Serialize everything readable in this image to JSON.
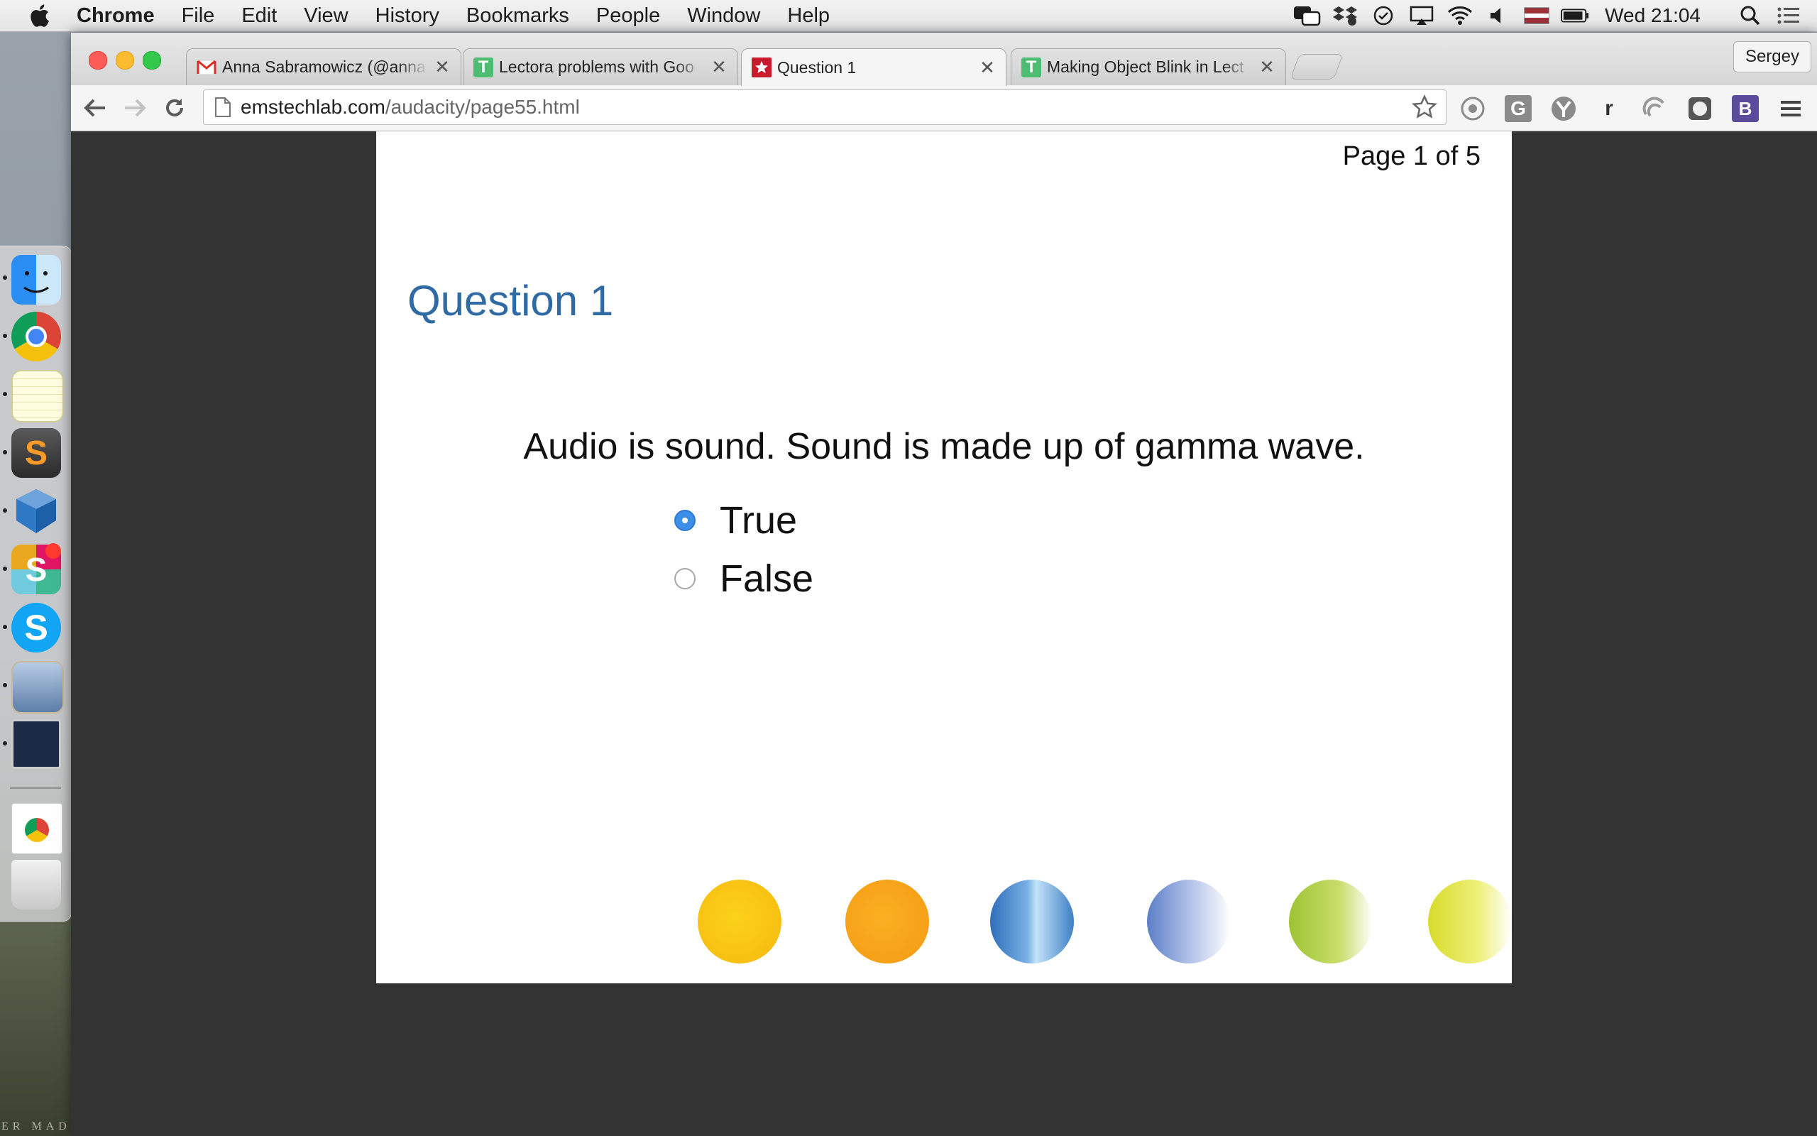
{
  "menubar": {
    "app_name": "Chrome",
    "items": [
      "File",
      "Edit",
      "View",
      "History",
      "Bookmarks",
      "People",
      "Window",
      "Help"
    ],
    "clock": "Wed 21:04"
  },
  "tabs": [
    {
      "title": "Anna Sabramowicz (@anna",
      "icon": "gmail-icon"
    },
    {
      "title": "Lectora problems with Goo",
      "icon": "lectora-icon"
    },
    {
      "title": "Question 1",
      "icon": "site-logo-icon",
      "active": true
    },
    {
      "title": "Making Object Blink in Lect",
      "icon": "lectora-icon"
    }
  ],
  "profile_name": "Sergey",
  "address": {
    "domain": "emstechlab.com",
    "path": "/audacity/page55.html"
  },
  "extensions": {
    "grammarly": "G",
    "readability": "r",
    "bootstrap": "B"
  },
  "page": {
    "page_number": "Page 1 of 5",
    "title": "Question 1",
    "question": "Audio is sound. Sound is made up of gamma wave.",
    "options": [
      {
        "label": "True",
        "selected": true
      },
      {
        "label": "False",
        "selected": false
      }
    ]
  },
  "desktop_watermark": "ER MAD",
  "colors": {
    "question_title": "#2f6aa3",
    "radio_selected": "#3d8ee9",
    "decor_circles": [
      "#f9c514",
      "#f8a51c",
      "#5b9bd5",
      "#8aa1d8",
      "#a8cc3e",
      "#e5e335"
    ]
  }
}
